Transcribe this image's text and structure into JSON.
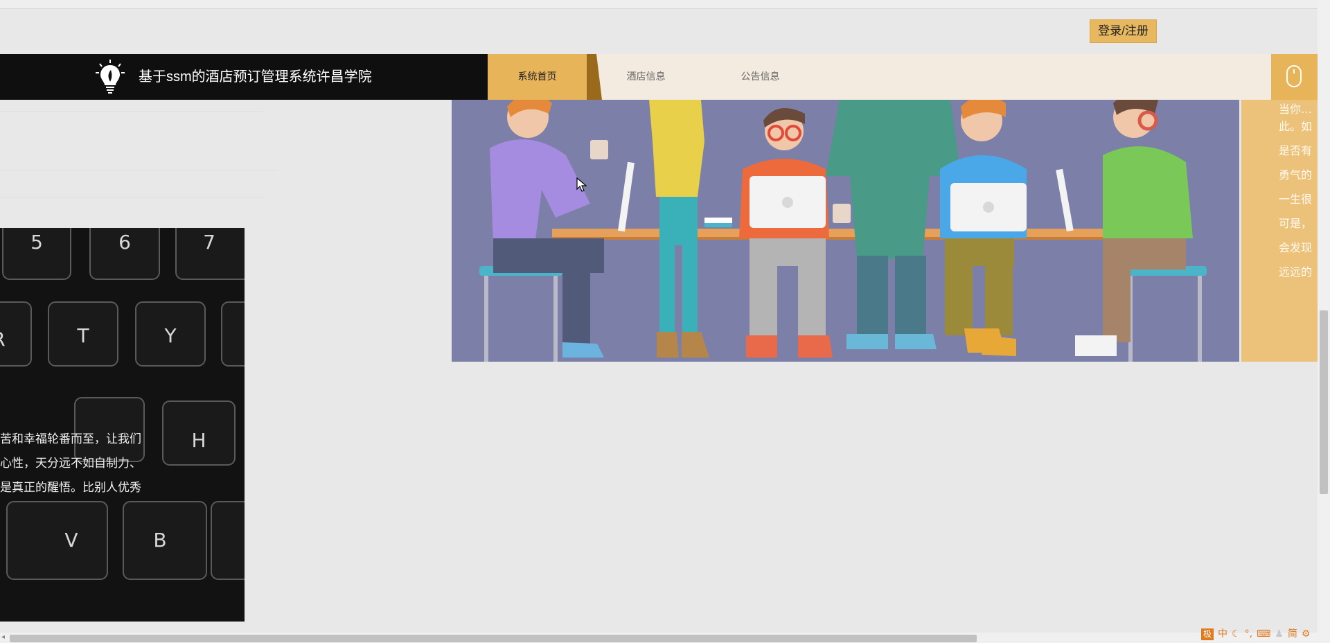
{
  "header": {
    "login_label": "登录/注册",
    "site_title": "基于ssm的酒店预订管理系统许昌学院"
  },
  "nav": {
    "items": [
      {
        "label": "系统首页",
        "active": true
      },
      {
        "label": "酒店信息",
        "active": false
      },
      {
        "label": "公告信息",
        "active": false
      }
    ]
  },
  "side_panel": {
    "lines": [
      "当你…",
      "此。如",
      "是否有",
      "勇气的",
      "一生很",
      "可是，",
      "会发现",
      "远远的"
    ]
  },
  "keyboard_card": {
    "keys": [
      "5",
      "6",
      "7",
      "R",
      "T",
      "Y",
      "H",
      "V",
      "B"
    ],
    "text_lines": [
      "苦和幸福轮番而至，让我们",
      "心性，天分远不如自制力、",
      "是真正的醒悟。比别人优秀"
    ]
  },
  "ime_toolbar": {
    "items": [
      "极",
      "中",
      "简"
    ]
  },
  "colors": {
    "accent": "#e8b45a",
    "brand_bg": "#0f0f0f",
    "nav_bg": "#f3ebdf",
    "side_panel": "#ecc17a",
    "illustration_bg": "#7c7fa8"
  }
}
